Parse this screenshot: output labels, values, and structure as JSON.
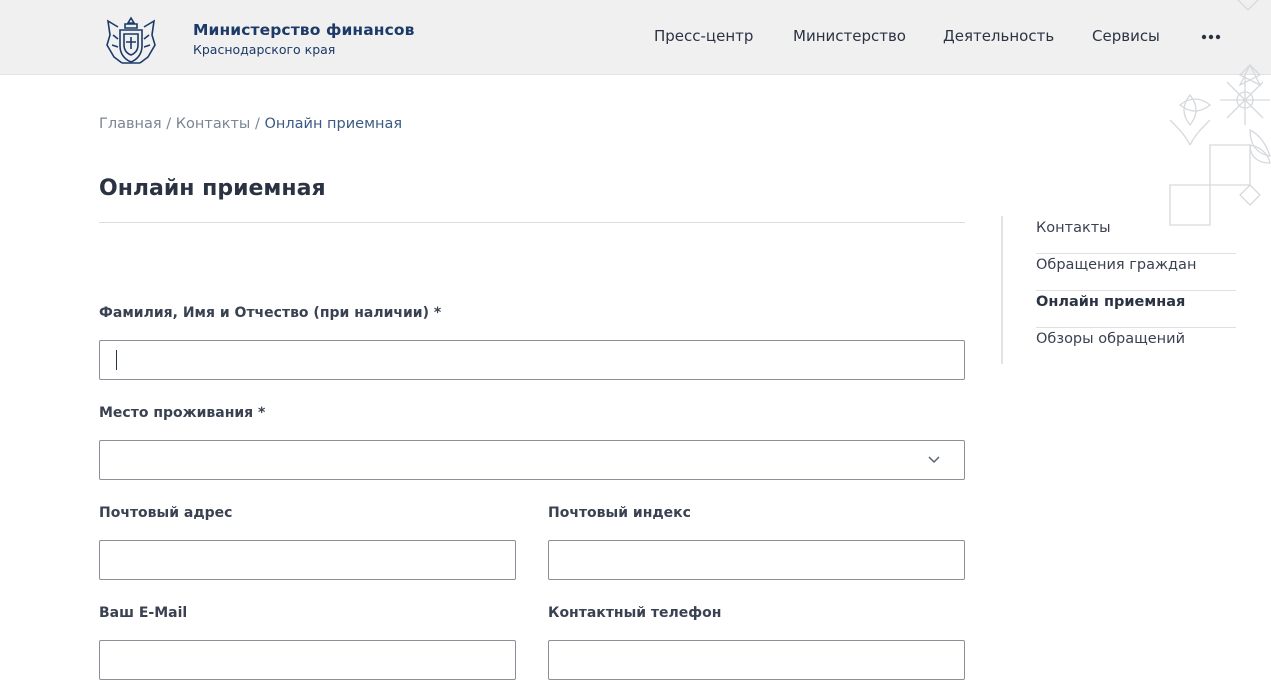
{
  "header": {
    "brand_title": "Министерство финансов",
    "brand_subtitle": "Краснодарского края",
    "nav": [
      "Пресс-центр",
      "Министерство",
      "Деятельность",
      "Сервисы"
    ],
    "more_icon": "more-horizontal-icon"
  },
  "breadcrumb": {
    "items": [
      "Главная",
      "Контакты",
      "Онлайн приемная"
    ],
    "separator": "/"
  },
  "page": {
    "title": "Онлайн приемная"
  },
  "form": {
    "fio_label": "Фамилия, Имя и Отчество (при наличии) *",
    "fio_value": "",
    "residence_label": "Место проживания *",
    "residence_value": "",
    "postal_address_label": "Почтовый адрес",
    "postal_index_label": "Почтовый индекс",
    "email_label": "Ваш E-Mail",
    "phone_label": "Контактный телефон"
  },
  "sidebar": {
    "items": [
      "Контакты",
      "Обращения граждан",
      "Онлайн приемная",
      "Обзоры обращений"
    ],
    "active_index": 2
  },
  "colors": {
    "header_bg": "#f0f0f0",
    "brand": "#1b3a68",
    "text": "#2b3343",
    "muted": "#7b8594",
    "breadcrumb_current": "#3c5a84"
  }
}
